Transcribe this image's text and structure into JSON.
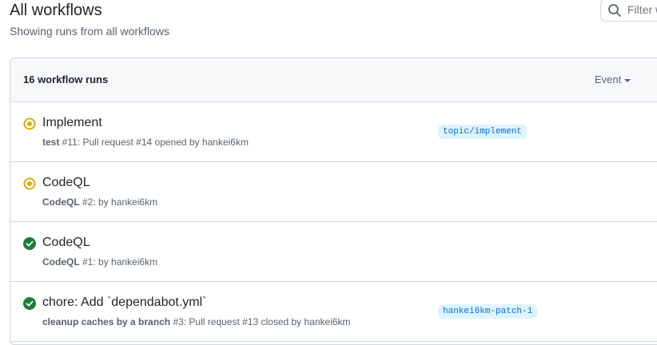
{
  "header": {
    "title": "All workflows",
    "subtitle": "Showing runs from all workflows"
  },
  "search": {
    "placeholder": "Filter workflow runs",
    "icon": "search-icon"
  },
  "runs": {
    "count_label": "16 workflow runs",
    "event_filter_label": "Event",
    "colors": {
      "in_progress": "#dbab0a",
      "success": "#1a7f37",
      "branch_text": "#0969da",
      "branch_bg": "#ddf4ff"
    },
    "items": [
      {
        "status": "in_progress",
        "title": "Implement",
        "workflow": "test",
        "meta": " #11: Pull request #14 opened by hankei6km",
        "branch": "topic/implement"
      },
      {
        "status": "in_progress",
        "title": "CodeQL",
        "workflow": "CodeQL",
        "meta": " #2: by hankei6km",
        "branch": ""
      },
      {
        "status": "success",
        "title": "CodeQL",
        "workflow": "CodeQL",
        "meta": " #1: by hankei6km",
        "branch": ""
      },
      {
        "status": "success",
        "title": "chore: Add `dependabot.yml`",
        "workflow": "cleanup caches by a branch",
        "meta": " #3: Pull request #13 closed by hankei6km",
        "branch": "hankei6km-patch-1"
      }
    ]
  }
}
